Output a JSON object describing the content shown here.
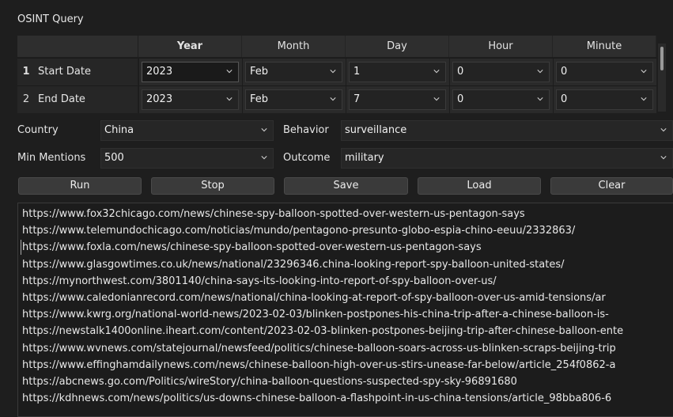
{
  "window": {
    "title": "OSINT Query"
  },
  "date_grid": {
    "columns": [
      "Year",
      "Month",
      "Day",
      "Hour",
      "Minute"
    ],
    "rows": [
      {
        "num": "1",
        "label": "Start Date",
        "year": "2023",
        "month": "Feb",
        "day": "1",
        "hour": "0",
        "minute": "0"
      },
      {
        "num": "2",
        "label": "End Date",
        "year": "2023",
        "month": "Feb",
        "day": "7",
        "hour": "0",
        "minute": "0"
      }
    ]
  },
  "form": {
    "country_label": "Country",
    "country_value": "China",
    "behavior_label": "Behavior",
    "behavior_value": "surveillance",
    "min_mentions_label": "Min Mentions",
    "min_mentions_value": "500",
    "outcome_label": "Outcome",
    "outcome_value": "military"
  },
  "buttons": {
    "run": "Run",
    "stop": "Stop",
    "save": "Save",
    "load": "Load",
    "clear": "Clear"
  },
  "results": [
    "https://www.fox32chicago.com/news/chinese-spy-balloon-spotted-over-western-us-pentagon-says",
    "https://www.telemundochicago.com/noticias/mundo/pentagono-presunto-globo-espia-chino-eeuu/2332863/",
    "https://www.foxla.com/news/chinese-spy-balloon-spotted-over-western-us-pentagon-says",
    "https://www.glasgowtimes.co.uk/news/national/23296346.china-looking-report-spy-balloon-united-states/",
    "https://mynorthwest.com/3801140/china-says-its-looking-into-report-of-spy-balloon-over-us/",
    "https://www.caledonianrecord.com/news/national/china-looking-at-report-of-spy-balloon-over-us-amid-tensions/ar",
    "https://www.kwrg.org/national-world-news/2023-02-03/blinken-postpones-his-china-trip-after-a-chinese-balloon-is-",
    "https://newstalk1400online.iheart.com/content/2023-02-03-blinken-postpones-beijing-trip-after-chinese-balloon-ente",
    "https://www.wvnews.com/statejournal/newsfeed/politics/chinese-balloon-soars-across-us-blinken-scraps-beijing-trip",
    "https://www.effinghamdailynews.com/news/chinese-balloon-high-over-us-stirs-unease-far-below/article_254f0862-a",
    "https://abcnews.go.com/Politics/wireStory/china-balloon-questions-suspected-spy-sky-96891680",
    "https://kdhnews.com/news/politics/us-downs-chinese-balloon-a-flashpoint-in-us-china-tensions/article_98bba806-6"
  ]
}
